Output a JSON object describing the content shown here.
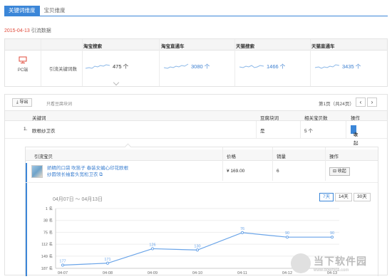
{
  "tabs": [
    {
      "label": "关键词维度",
      "active": true
    },
    {
      "label": "宝贝维度",
      "active": false
    }
  ],
  "header": {
    "date": "2015-04-13",
    "title": "引流数据"
  },
  "stats": {
    "columns": [
      "淘宝搜索",
      "淘宝直通车",
      "天猫搜索",
      "天猫直通车"
    ],
    "device": "PC端",
    "row_label": "引流关键词数",
    "values": [
      "475 个",
      "3080 个",
      "1466 个",
      "3435 个"
    ]
  },
  "toolbar": {
    "export_label": "导出",
    "only_label": "只看豆腐块词",
    "pager_text": "第1页（共24页）",
    "prev": "‹",
    "next": "›"
  },
  "keyword_table": {
    "headers": [
      "关键词",
      "豆腐块词",
      "相关宝贝数",
      "操作"
    ],
    "rows": [
      {
        "index": "1.",
        "keyword": "欧根纱卫衣",
        "tofu": "是",
        "count": "5 个",
        "action": "收起"
      }
    ]
  },
  "sub_table": {
    "headers": [
      "引流宝贝",
      "价格",
      "销量",
      "操作"
    ],
    "rows": [
      {
        "title_line1": "娇精的口袋 吹笛子 春装女蝙心印花欧根",
        "title_line2": "纱圆领长袖套头宽松卫衣",
        "price": "¥ 169.00",
        "sales": "6",
        "action": "收起"
      }
    ]
  },
  "range": {
    "label": "04月07日 ～ 04月13日",
    "buttons": [
      {
        "label": "7天",
        "active": true
      },
      {
        "label": "14天",
        "active": false
      },
      {
        "label": "30天",
        "active": false
      }
    ]
  },
  "chart_data": {
    "type": "line",
    "title": "",
    "x": [
      "04-07",
      "04-08",
      "04-09",
      "04-10",
      "04-11",
      "04-12",
      "04-13"
    ],
    "y": [
      177,
      171,
      126,
      130,
      76,
      90,
      90
    ],
    "data_labels": [
      "177",
      "171",
      "126",
      "130",
      "76",
      "90",
      "90"
    ],
    "y_ticks": [
      "1 名",
      "38 名",
      "75 名",
      "112 名",
      "149 名",
      "187 名"
    ],
    "y_tick_values": [
      1,
      38,
      75,
      112,
      149,
      187
    ],
    "ylim": [
      1,
      187
    ],
    "y_reversed": true,
    "grid": true,
    "color": "#6aa4e8"
  },
  "watermark": {
    "cn": "当下软件园",
    "url": "www.downxia.com"
  }
}
